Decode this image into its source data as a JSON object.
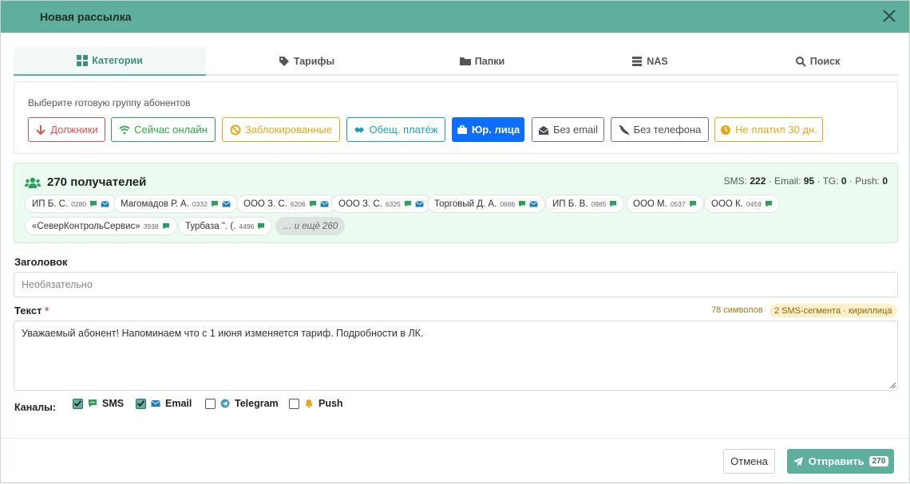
{
  "modal": {
    "title": "Новая рассылка"
  },
  "tabs": [
    {
      "label": "Категории",
      "icon": "grid-icon",
      "active": true
    },
    {
      "label": "Тарифы",
      "icon": "tags-icon"
    },
    {
      "label": "Папки",
      "icon": "folder-icon"
    },
    {
      "label": "NAS",
      "icon": "server-icon"
    },
    {
      "label": "Поиск",
      "icon": "search-icon"
    }
  ],
  "groups": {
    "hint": "Выберите готовую группу абонентов",
    "buttons": [
      {
        "label": "Должники",
        "icon": "arrow-down-icon",
        "color": "#d9534f"
      },
      {
        "label": "Сейчас онлайн",
        "icon": "wifi-icon",
        "color": "#28a745"
      },
      {
        "label": "Заблокированные",
        "icon": "ban-icon",
        "color": "#e6a817"
      },
      {
        "label": "Обещ. платёж",
        "icon": "handshake-icon",
        "color": "#17a2b8"
      },
      {
        "label": "Юр. лица",
        "icon": "briefcase-icon",
        "color": "#0d6efd",
        "active": true
      },
      {
        "label": "Без email",
        "icon": "envelope-open-icon",
        "color": "#495057"
      },
      {
        "label": "Без телефона",
        "icon": "phone-slash-icon",
        "color": "#495057"
      },
      {
        "label": "Не платил 30 дн.",
        "icon": "clock-icon",
        "color": "#e6a817"
      }
    ]
  },
  "recipients": {
    "title": "270 получателей",
    "stats": {
      "sms_label": "SMS:",
      "sms": "222",
      "email_label": "· Email:",
      "email": "95",
      "tg_label": "· TG:",
      "tg": "0",
      "push_label": "· Push:",
      "push": "0"
    },
    "chips": [
      {
        "name": "ИП Б. С.",
        "num": "0280",
        "sms": true,
        "email": true
      },
      {
        "name": "Магомадов Р. А.",
        "num": "0332",
        "sms": true,
        "email": true
      },
      {
        "name": "ООО З. С.",
        "num": "6206",
        "sms": true,
        "email": true
      },
      {
        "name": "ООО З. С.",
        "num": "6325",
        "sms": true,
        "email": true
      },
      {
        "name": "Торговый Д. А.",
        "num": "0686",
        "sms": true,
        "email": true
      },
      {
        "name": "ИП Б. В.",
        "num": "0985",
        "sms": true,
        "email": false
      },
      {
        "name": "ООО М.",
        "num": "0537",
        "sms": true,
        "email": false
      },
      {
        "name": "ООО К.",
        "num": "0459",
        "sms": true,
        "email": false
      },
      {
        "name": "«СеверКонтрольСервис»",
        "num": "3938",
        "sms": true,
        "email": false
      },
      {
        "name": "Турбаза \". (.",
        "num": "4496",
        "sms": true,
        "email": false
      }
    ],
    "more": "… и ещё 260"
  },
  "form": {
    "subject_label": "Заголовок",
    "subject_placeholder": "Необязательно",
    "subject_value": "",
    "text_label": "Текст",
    "text_required": "*",
    "text_value": "Уважаемый абонент! Напоминаем что с 1 июня изменяется тариф. Подробности в ЛК.",
    "char_count": "78 символов",
    "segments": "2 SMS-сегмента · кириллица"
  },
  "channels": {
    "label": "Каналы:",
    "items": [
      {
        "label": "SMS",
        "checked": true,
        "icon": "sms-icon"
      },
      {
        "label": "Email",
        "checked": true,
        "icon": "envelope-icon"
      },
      {
        "label": "Telegram",
        "checked": false,
        "icon": "telegram-icon"
      },
      {
        "label": "Push",
        "checked": false,
        "icon": "bell-icon"
      }
    ]
  },
  "footer": {
    "cancel": "Отмена",
    "send": "Отправить",
    "send_count": "270"
  },
  "colors": {
    "accent": "#5faf9d",
    "recipients_bg": "#ecfbef"
  }
}
